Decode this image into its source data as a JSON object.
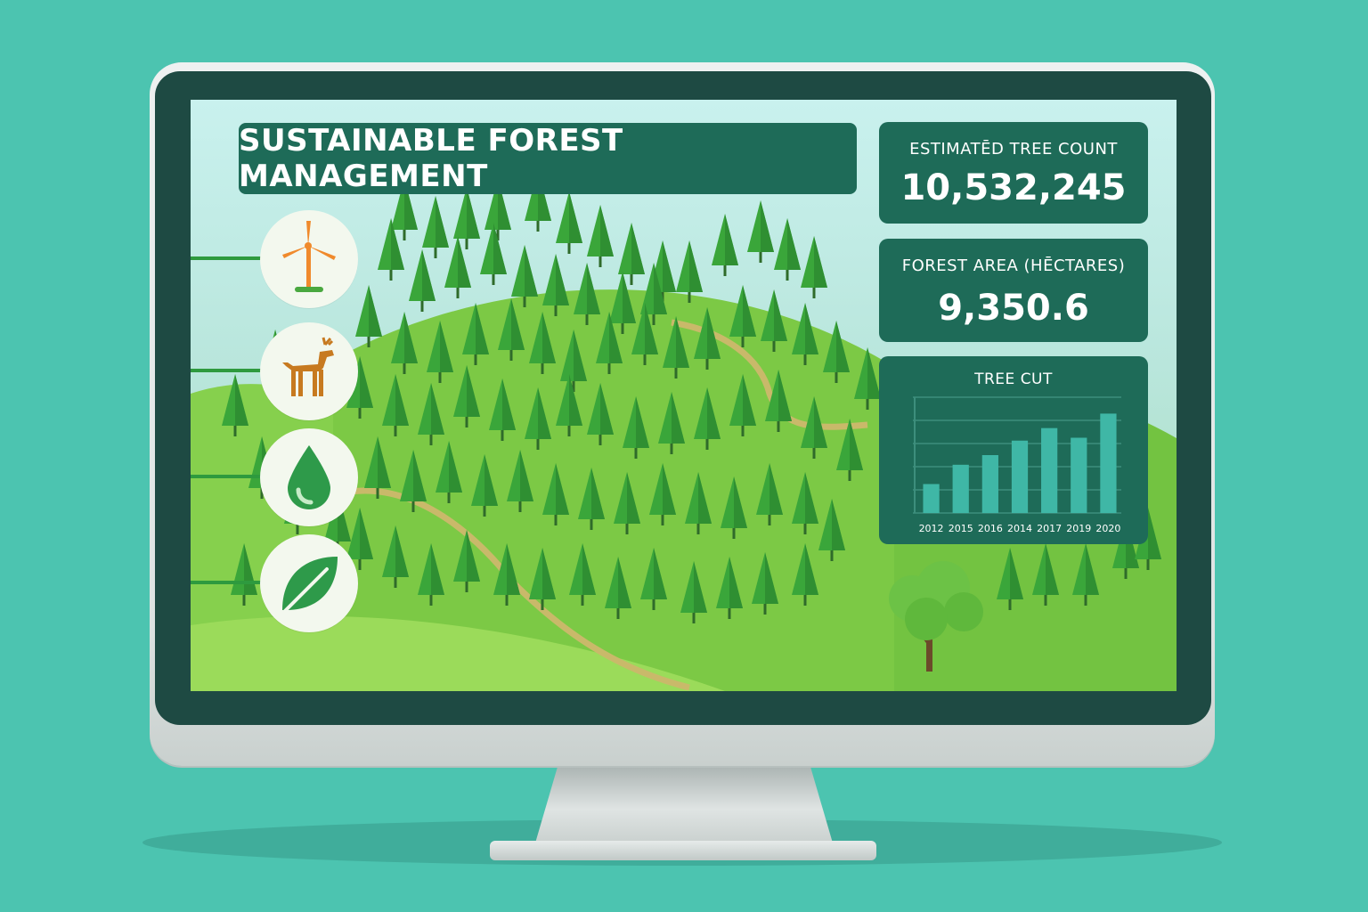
{
  "app": {
    "title": "SUSTAINABLE FOREST MANAGEMENT"
  },
  "stats": {
    "tree_count": {
      "label": "ESTIMATĒD TREE COUNT",
      "value": "10,532,245"
    },
    "forest_area": {
      "label": "FOREST AREA (HĒCTARES)",
      "value": "9,350.6"
    }
  },
  "icons": [
    {
      "name": "wind-turbine-icon",
      "color": "#f08a2c"
    },
    {
      "name": "deer-icon",
      "color": "#c77a20"
    },
    {
      "name": "water-drop-icon",
      "color": "#2e9a4a"
    },
    {
      "name": "leaf-icon",
      "color": "#2e9a4a"
    }
  ],
  "colors": {
    "background": "#4cc4b0",
    "panel": "#1e6b58",
    "bar": "#3fb7a6",
    "tree": "#3aa63a"
  },
  "chart_data": {
    "type": "bar",
    "title": "TREE CUT",
    "categories": [
      "2012",
      "2015",
      "2016",
      "2014",
      "2017",
      "2019",
      "2020"
    ],
    "values": [
      3,
      5,
      6,
      7.5,
      8.8,
      7.8,
      10.3
    ],
    "ylim": [
      0,
      12
    ],
    "grid": true,
    "xlabel": "",
    "ylabel": ""
  }
}
